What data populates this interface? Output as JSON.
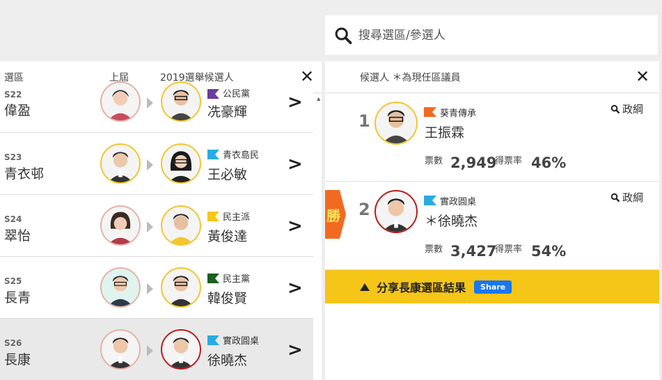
{
  "search": {
    "placeholder": "搜尋選區/參選人"
  },
  "left_panel": {
    "headers": {
      "district": "選區",
      "previous": "上屆",
      "candidates": "2019選舉候選人"
    },
    "rows": [
      {
        "code": "S22",
        "district": "偉盈",
        "party": "公民黨",
        "party_color": "#6a3d9a",
        "candidate": "冼豪輝",
        "selected": false
      },
      {
        "code": "S23",
        "district": "青衣邨",
        "party": "青衣島民",
        "party_color": "#29abe2",
        "candidate": "王必敏",
        "selected": false
      },
      {
        "code": "S24",
        "district": "翠怡",
        "party": "民主派",
        "party_color": "#f5c518",
        "candidate": "黃俊達",
        "selected": false
      },
      {
        "code": "S25",
        "district": "長青",
        "party": "民主黨",
        "party_color": "#1b5e20",
        "candidate": "韓俊賢",
        "selected": false
      },
      {
        "code": "S26",
        "district": "長康",
        "party": "實政圓桌",
        "party_color": "#29abe2",
        "candidate": "徐曉杰",
        "selected": true
      }
    ]
  },
  "right_panel": {
    "title": "候選人 ＊為現任區議員",
    "candidates": [
      {
        "number": "1",
        "party": "葵青傳承",
        "party_color": "#f26a21",
        "name": "王振霖",
        "policy_label": "政綱",
        "votes_label": "票數",
        "votes": "2,949",
        "rate_label": "得票率",
        "rate": "46%",
        "winner": false
      },
      {
        "number": "2",
        "party": "實政圓桌",
        "party_color": "#29abe2",
        "name": "＊徐曉杰",
        "policy_label": "政綱",
        "votes_label": "票數",
        "votes": "3,427",
        "rate_label": "得票率",
        "rate": "54%",
        "winner": true,
        "winner_label": "勝"
      }
    ],
    "share": {
      "text": "分享長康選區結果",
      "button": "Share"
    }
  }
}
